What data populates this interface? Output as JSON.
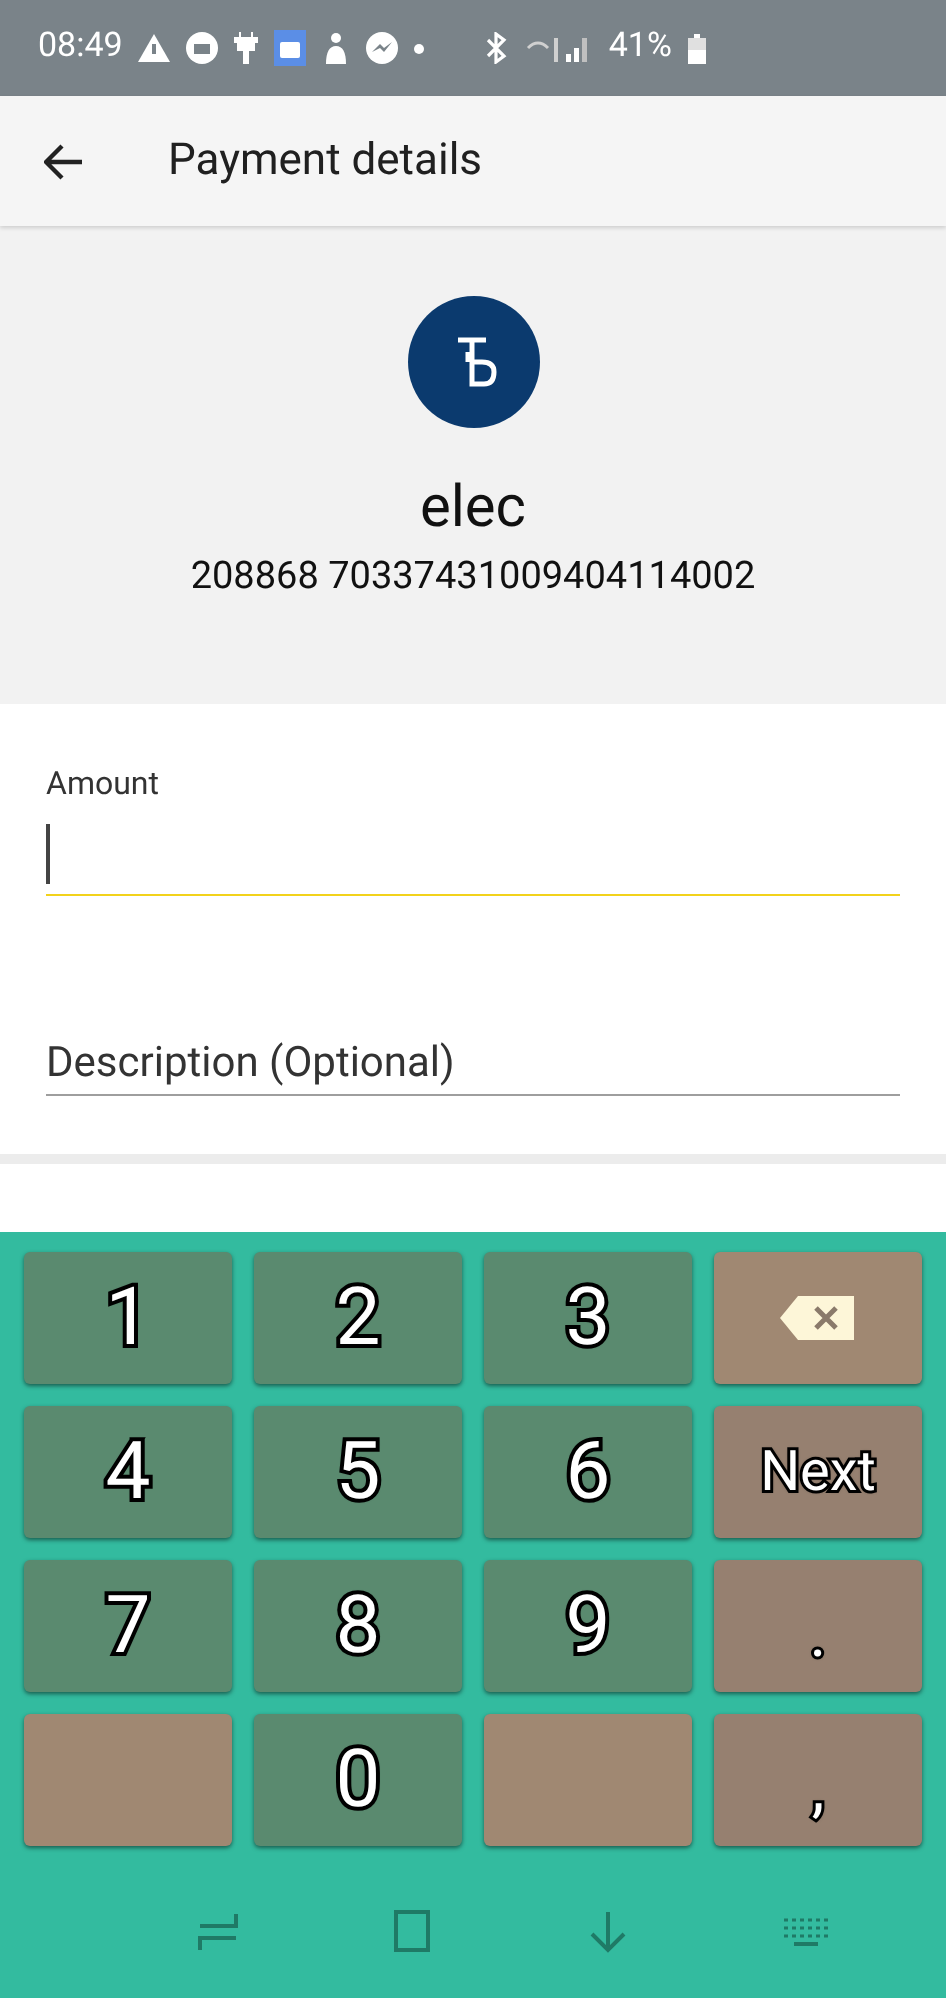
{
  "status_bar": {
    "time": "08:49",
    "battery": "41%"
  },
  "app_bar": {
    "title": "Payment details"
  },
  "payee": {
    "name": "elec",
    "account": "208868 70337431009404114002"
  },
  "form": {
    "fields": [
      {
        "label": "Amount",
        "focused": true
      },
      {
        "placeholder": "Description (Optional)",
        "focused": false
      }
    ]
  },
  "keypad": {
    "keys": [
      {
        "kind": "number",
        "label": "1"
      },
      {
        "kind": "number",
        "label": "2"
      },
      {
        "kind": "number",
        "label": "3"
      },
      {
        "kind": "backspace"
      },
      {
        "kind": "number",
        "label": "4"
      },
      {
        "kind": "number",
        "label": "5"
      },
      {
        "kind": "number",
        "label": "6"
      },
      {
        "kind": "action",
        "label": "Next"
      },
      {
        "kind": "number",
        "label": "7"
      },
      {
        "kind": "number",
        "label": "8"
      },
      {
        "kind": "number",
        "label": "9"
      },
      {
        "kind": "action",
        "label": "."
      },
      {
        "kind": "blank"
      },
      {
        "kind": "number",
        "label": "0"
      },
      {
        "kind": "blank"
      },
      {
        "kind": "action",
        "label": ","
      }
    ]
  }
}
